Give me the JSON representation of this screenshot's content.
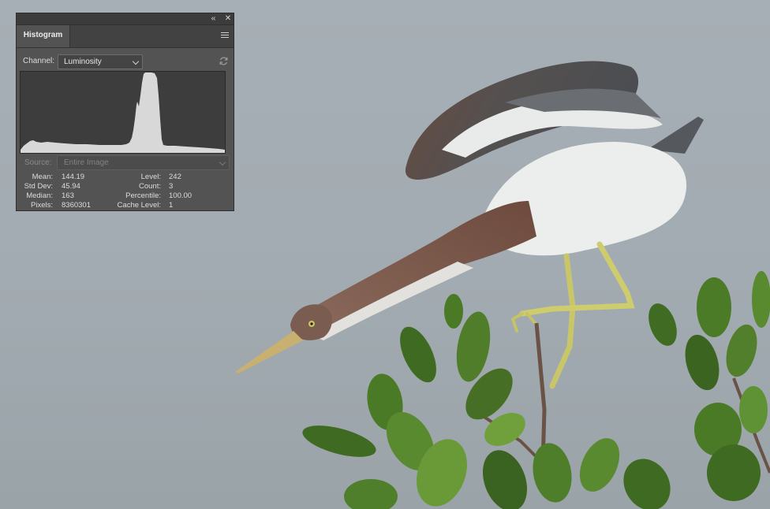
{
  "panel": {
    "collapse_glyph": "‹‹",
    "close_glyph": "✕",
    "tab_label": "Histogram",
    "menu_icon": "hamburger-menu-icon",
    "channel_label": "Channel:",
    "channel_value": "Luminosity",
    "refresh_icon": "refresh-icon",
    "source_label": "Source:",
    "source_value": "Entire Image",
    "stats_left": [
      {
        "label": "Mean:",
        "value": "144.19"
      },
      {
        "label": "Std Dev:",
        "value": "45.94"
      },
      {
        "label": "Median:",
        "value": "163"
      },
      {
        "label": "Pixels:",
        "value": "8360301"
      }
    ],
    "stats_right": [
      {
        "label": "Level:",
        "value": "242"
      },
      {
        "label": "Count:",
        "value": "3"
      },
      {
        "label": "Percentile:",
        "value": "100.00"
      },
      {
        "label": "Cache Level:",
        "value": "1"
      }
    ]
  },
  "colors": {
    "panel_bg": "#535353",
    "histogram_fill": "#d8d8d8",
    "histogram_bg": "#3d3d3d"
  }
}
